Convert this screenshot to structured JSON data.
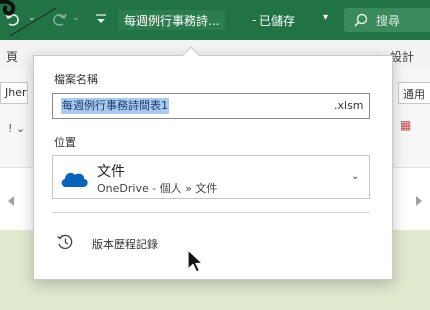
{
  "titlebar": {
    "filename": "每週例行事務詩...",
    "separator": "-",
    "saved_status": "已儲存",
    "search_placeholder": "搜尋",
    "bg_color": "#217346"
  },
  "ribbon": {
    "tab_left": "頁",
    "tab_right": "設計",
    "font_box": "Jher",
    "number_format": "通用",
    "left_caret": "! ⌄"
  },
  "file_popup": {
    "filename_label": "檔案名稱",
    "filename_value": "每週例行事務詩間表1",
    "file_extension": ".xlsm",
    "location_label": "位置",
    "location_title": "文件",
    "location_path": "OneDrive - 個人 » 文件",
    "location_icon": "onedrive-cloud-icon",
    "version_history_label": "版本歷程記錄",
    "version_history_icon": "history-icon"
  },
  "colors": {
    "excel_green": "#217346",
    "selection_blue": "#aacbef",
    "onedrive_blue": "#0364b8",
    "sheet_green": "#dfe9ce"
  }
}
